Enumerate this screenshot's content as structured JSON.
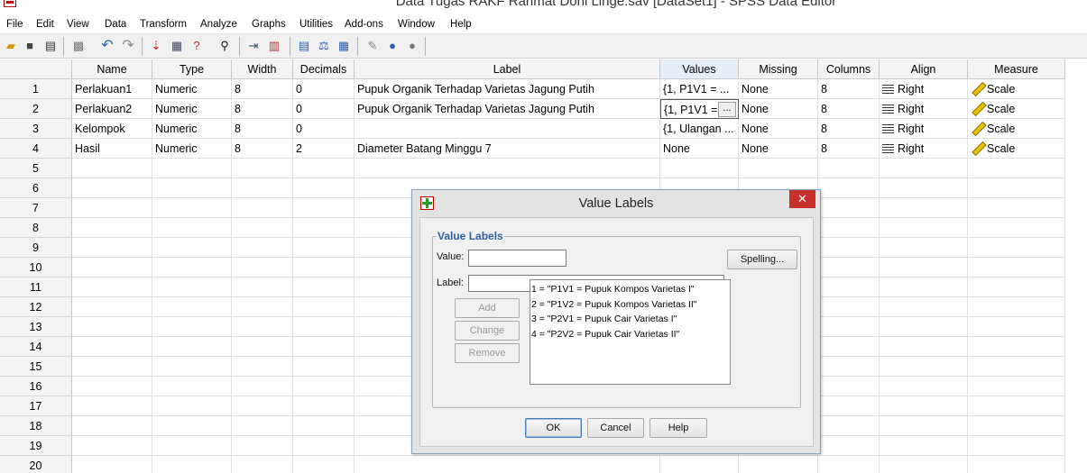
{
  "window": {
    "title": "Data Tugas RAKF Rahmat Doni Linge.sav [DataSet1] - SPSS Data Editor"
  },
  "menu": [
    "File",
    "Edit",
    "View",
    "Data",
    "Transform",
    "Analyze",
    "Graphs",
    "Utilities",
    "Add-ons",
    "Window",
    "Help"
  ],
  "toolbar": {
    "icons": [
      "open-folder-icon",
      "save-icon",
      "print-icon",
      "dialog-recall-icon",
      "undo-icon",
      "redo-icon",
      "goto-case-icon",
      "variables-icon",
      "find-icon",
      "insert-cases-icon",
      "insert-variable-icon",
      "split-file-icon",
      "weight-cases-icon",
      "select-cases-icon",
      "value-labels-icon",
      "use-sets-icon",
      "show-all-variables-icon"
    ]
  },
  "grid": {
    "columns": [
      "Name",
      "Type",
      "Width",
      "Decimals",
      "Label",
      "Values",
      "Missing",
      "Columns",
      "Align",
      "Measure"
    ],
    "rows": [
      {
        "num": "1",
        "name": "Perlakuan1",
        "type": "Numeric",
        "width": "8",
        "decimals": "0",
        "label": "Pupuk Organik Terhadap Varietas Jagung Putih",
        "values": "{1, P1V1 = ...",
        "missing": "None",
        "columns": "8",
        "align": "Right",
        "measure": "Scale"
      },
      {
        "num": "2",
        "name": "Perlakuan2",
        "type": "Numeric",
        "width": "8",
        "decimals": "0",
        "label": "Pupuk Organik Terhadap Varietas Jagung Putih",
        "values": "{1, P1V1 =",
        "missing": "None",
        "columns": "8",
        "align": "Right",
        "measure": "Scale"
      },
      {
        "num": "3",
        "name": "Kelompok",
        "type": "Numeric",
        "width": "8",
        "decimals": "0",
        "label": "",
        "values": "{1, Ulangan ...",
        "missing": "None",
        "columns": "8",
        "align": "Right",
        "measure": "Scale"
      },
      {
        "num": "4",
        "name": "Hasil",
        "type": "Numeric",
        "width": "8",
        "decimals": "2",
        "label": "Diameter Batang Minggu 7",
        "values": "None",
        "missing": "None",
        "columns": "8",
        "align": "Right",
        "measure": "Scale"
      }
    ],
    "empty_rows": [
      "5",
      "6",
      "7",
      "8",
      "9",
      "10",
      "11",
      "12",
      "13",
      "14",
      "15",
      "16",
      "17",
      "18",
      "19",
      "20"
    ],
    "ellipsis": "..."
  },
  "dialog": {
    "title": "Value Labels",
    "close": "✕",
    "group_title": "Value Labels",
    "value_label": "Value:",
    "value_input": "",
    "label_label": "Label:",
    "label_input": "",
    "spelling_button": "Spelling...",
    "add_button": "Add",
    "change_button": "Change",
    "remove_button": "Remove",
    "list_items": [
      "1 = \"P1V1 = Pupuk Kompos Varietas I\"",
      "2 = \"P1V2 = Pupuk Kompos Varietas II\"",
      "3 = \"P2V1 = Pupuk Cair Varietas I\"",
      "4 = \"P2V2 = Pupuk Cair Varietas II\""
    ],
    "ok_button": "OK",
    "cancel_button": "Cancel",
    "help_button": "Help"
  },
  "colors": {
    "accent": "#2f5ea0",
    "close_button": "#c9302c"
  }
}
